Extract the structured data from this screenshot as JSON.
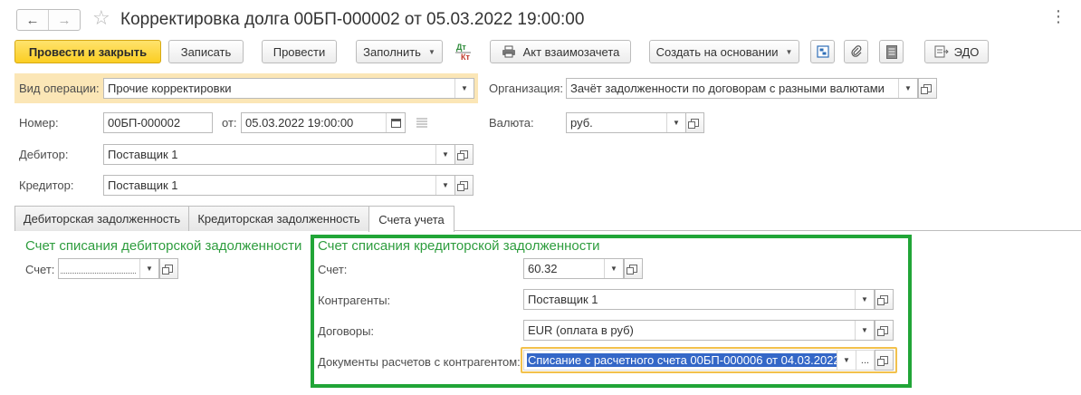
{
  "window": {
    "title": "Корректировка долга 00БП-000002 от 05.03.2022 19:00:00",
    "more_label": "⋮"
  },
  "toolbar": {
    "post_close": "Провести и закрыть",
    "save": "Записать",
    "post": "Провести",
    "fill": "Заполнить",
    "dtkt_top": "Дт",
    "dtkt_bottom": "Кт",
    "act": "Акт взаимозачета",
    "create_based": "Создать на основании",
    "edo": "ЭДО"
  },
  "header": {
    "operation_label": "Вид операции:",
    "operation_value": "Прочие корректировки",
    "organization_label": "Организация:",
    "organization_value": "Зачёт задолженности по договорам с разными валютами",
    "number_label": "Номер:",
    "number_value": "00БП-000002",
    "date_label": "от:",
    "date_value": "05.03.2022 19:00:00",
    "currency_label": "Валюта:",
    "currency_value": "руб.",
    "debtor_label": "Дебитор:",
    "debtor_value": "Поставщик 1",
    "creditor_label": "Кредитор:",
    "creditor_value": "Поставщик 1"
  },
  "tabs": [
    {
      "label": "Дебиторская задолженность"
    },
    {
      "label": "Кредиторская задолженность"
    },
    {
      "label": "Счета учета"
    }
  ],
  "debit_section": {
    "title": "Счет списания дебиторской задолженности",
    "account_label": "Счет:",
    "account_value": ""
  },
  "credit_section": {
    "title": "Счет списания кредиторской задолженности",
    "account_label": "Счет:",
    "account_value": "60.32",
    "counterparties_label": "Контрагенты:",
    "counterparties_value": "Поставщик 1",
    "contracts_label": "Договоры:",
    "contracts_value": "EUR (оплата в руб)",
    "documents_label": "Документы расчетов с контрагентом:",
    "documents_value": "Списание с расчетного счета 00БП-000006 от 04.03.2022"
  },
  "colors": {
    "primary_button": "#fbce22",
    "highlight_row": "#fbe6b6",
    "group_title": "#2e9d3e",
    "group_frame": "#21a537",
    "focus_frame": "#f2c14c",
    "selection": "#3467c7"
  }
}
